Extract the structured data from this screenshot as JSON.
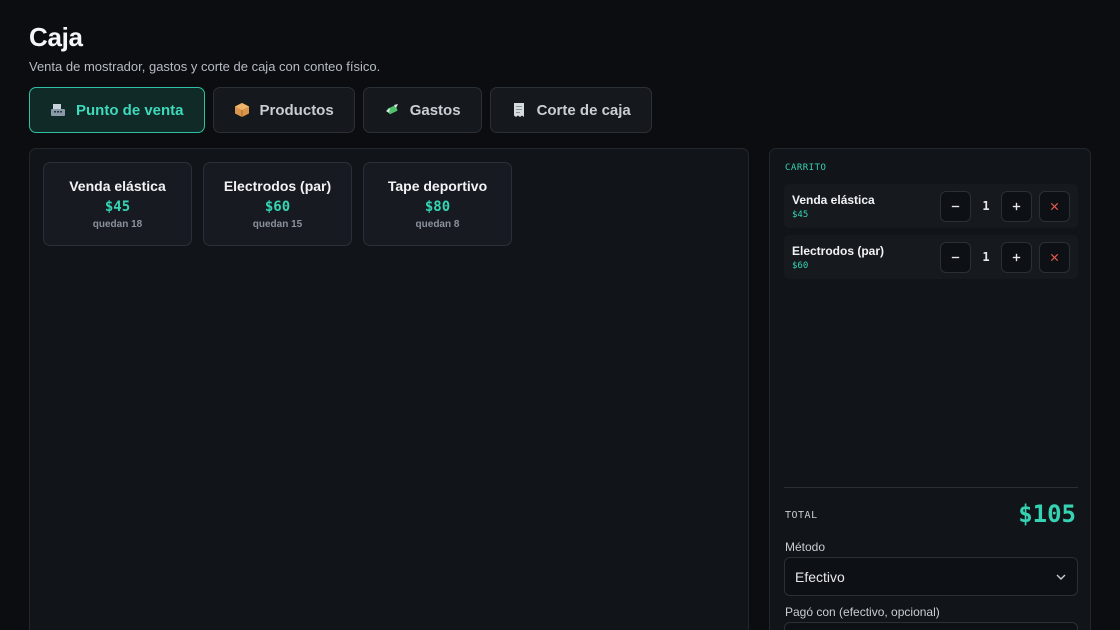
{
  "header": {
    "title": "Caja",
    "subtitle": "Venta de mostrador, gastos y corte de caja con conteo físico."
  },
  "tabs": [
    {
      "label": "Punto de venta",
      "icon": "cash-register-icon",
      "active": true
    },
    {
      "label": "Productos",
      "icon": "package-icon",
      "active": false
    },
    {
      "label": "Gastos",
      "icon": "money-wings-icon",
      "active": false
    },
    {
      "label": "Corte de caja",
      "icon": "receipt-icon",
      "active": false
    }
  ],
  "products": [
    {
      "name": "Venda elástica",
      "price": "$45",
      "stock": "quedan 18"
    },
    {
      "name": "Electrodos (par)",
      "price": "$60",
      "stock": "quedan 15"
    },
    {
      "name": "Tape deportivo",
      "price": "$80",
      "stock": "quedan 8"
    }
  ],
  "cart": {
    "heading": "CARRITO",
    "items": [
      {
        "name": "Venda elástica",
        "price": "$45",
        "qty": "1"
      },
      {
        "name": "Electrodos (par)",
        "price": "$60",
        "qty": "1"
      }
    ],
    "total_label": "TOTAL",
    "total_value": "$105",
    "method_label": "Método",
    "method_value": "Efectivo",
    "paid_label": "Pagó con (efectivo, opcional)"
  },
  "colors": {
    "accent": "#36d3b3",
    "background": "#0b0d10",
    "danger": "#e05a4a"
  }
}
